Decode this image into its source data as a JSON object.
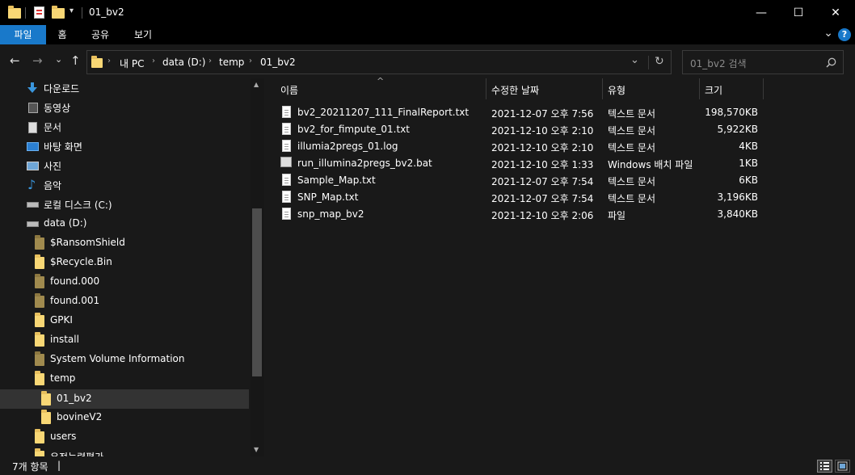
{
  "window": {
    "title": "01_bv2",
    "minimize": "—",
    "maximize": "☐",
    "close": "✕"
  },
  "ribbon": {
    "tabs": [
      "파일",
      "홈",
      "공유",
      "보기"
    ],
    "chevron": "⌄",
    "help": "?"
  },
  "nav": {
    "back": "←",
    "forward": "→",
    "recent": "⌄",
    "up": "↑"
  },
  "address": {
    "crumbs": [
      "내 PC",
      "data (D:)",
      "temp",
      "01_bv2"
    ],
    "dropdown": "⌄",
    "refresh": "↻"
  },
  "search": {
    "placeholder": "01_bv2 검색"
  },
  "navpane": {
    "items": [
      {
        "label": "다운로드",
        "icon": "download-icon"
      },
      {
        "label": "동영상",
        "icon": "video-icon"
      },
      {
        "label": "문서",
        "icon": "document-icon"
      },
      {
        "label": "바탕 화면",
        "icon": "desktop-icon"
      },
      {
        "label": "사진",
        "icon": "pictures-icon"
      },
      {
        "label": "음악",
        "icon": "music-icon"
      },
      {
        "label": "로컬 디스크 (C:)",
        "icon": "drive-icon"
      },
      {
        "label": "data (D:)",
        "icon": "drive-icon"
      },
      {
        "label": "$RansomShield",
        "icon": "folder-icon"
      },
      {
        "label": "$Recycle.Bin",
        "icon": "folder-icon"
      },
      {
        "label": "found.000",
        "icon": "folder-icon"
      },
      {
        "label": "found.001",
        "icon": "folder-icon"
      },
      {
        "label": "GPKI",
        "icon": "folder-icon"
      },
      {
        "label": "install",
        "icon": "folder-icon"
      },
      {
        "label": "System Volume Information",
        "icon": "folder-icon"
      },
      {
        "label": "temp",
        "icon": "folder-icon"
      },
      {
        "label": "01_bv2",
        "icon": "folder-icon"
      },
      {
        "label": "bovineV2",
        "icon": "folder-icon"
      },
      {
        "label": "users",
        "icon": "folder-icon"
      },
      {
        "label": "유전능력평가",
        "icon": "folder-icon"
      }
    ]
  },
  "columns": {
    "name": "이름",
    "modified": "수정한 날짜",
    "type": "유형",
    "size": "크기",
    "sort_indicator": "^"
  },
  "files": [
    {
      "name": "bv2_20211207_111_FinalReport.txt",
      "modified": "2021-12-07 오후 7:56",
      "type": "텍스트 문서",
      "size": "198,570KB",
      "icon": "text-file-icon"
    },
    {
      "name": "bv2_for_fimpute_01.txt",
      "modified": "2021-12-10 오후 2:10",
      "type": "텍스트 문서",
      "size": "5,922KB",
      "icon": "text-file-icon"
    },
    {
      "name": "illumia2pregs_01.log",
      "modified": "2021-12-10 오후 2:10",
      "type": "텍스트 문서",
      "size": "4KB",
      "icon": "text-file-icon"
    },
    {
      "name": "run_illumina2pregs_bv2.bat",
      "modified": "2021-12-10 오후 1:33",
      "type": "Windows 배치 파일",
      "size": "1KB",
      "icon": "batch-file-icon"
    },
    {
      "name": "Sample_Map.txt",
      "modified": "2021-12-07 오후 7:54",
      "type": "텍스트 문서",
      "size": "6KB",
      "icon": "text-file-icon"
    },
    {
      "name": "SNP_Map.txt",
      "modified": "2021-12-07 오후 7:54",
      "type": "텍스트 문서",
      "size": "3,196KB",
      "icon": "text-file-icon"
    },
    {
      "name": "snp_map_bv2",
      "modified": "2021-12-10 오후 2:06",
      "type": "파일",
      "size": "3,840KB",
      "icon": "file-icon"
    }
  ],
  "status": {
    "count": "7개 항목",
    "cursor": "|"
  },
  "colors": {
    "background": "#191919",
    "titlebar": "#000000",
    "accent": "#1979ca",
    "folder": "#f8d775",
    "selected": "#333333"
  }
}
